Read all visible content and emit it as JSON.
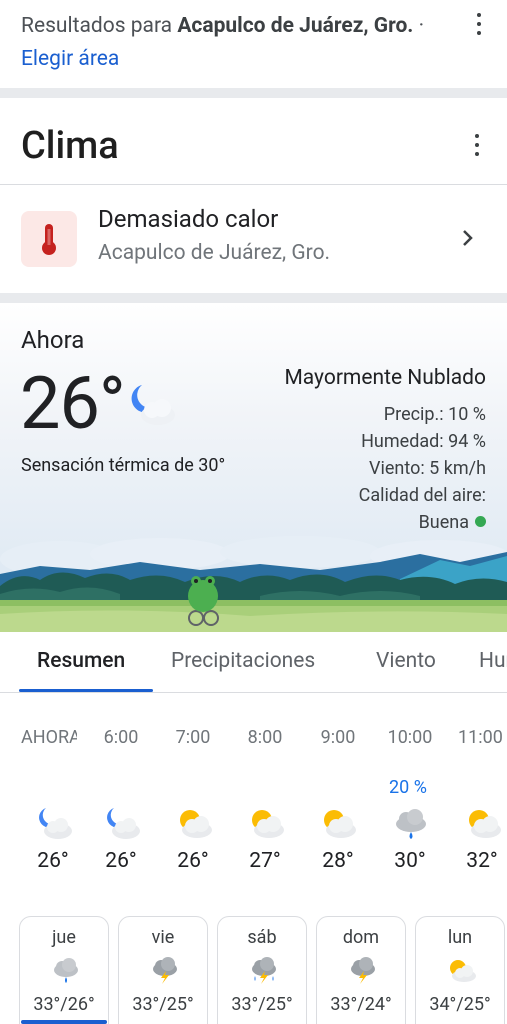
{
  "results": {
    "prefix": "Resultados para ",
    "location": "Acapulco de Juárez, Gro.",
    "separator": " · ",
    "link": "Elegir área"
  },
  "card": {
    "title": "Clima"
  },
  "alert": {
    "title": "Demasiado calor",
    "subtitle": "Acapulco de Juárez, Gro."
  },
  "current": {
    "label": "Ahora",
    "temp": "26°",
    "feels_like": "Sensación térmica de 30°",
    "condition": "Mayormente Nublado",
    "precip": "Precip.: 10 %",
    "humidity": "Humedad: 94 %",
    "wind": "Viento: 5 km/h",
    "air_quality_label": "Calidad del aire:",
    "air_quality_value": "Buena",
    "air_quality_color": "#34a853"
  },
  "tabs": [
    {
      "label": "Resumen"
    },
    {
      "label": "Precipitaciones"
    },
    {
      "label": "Viento"
    },
    {
      "label": "Humedad"
    }
  ],
  "hourly": [
    {
      "time": "AHORA",
      "temp": "26°",
      "precip": "",
      "icon": "night-partly-cloudy-icon"
    },
    {
      "time": "6:00",
      "temp": "26°",
      "precip": "",
      "icon": "night-partly-cloudy-icon"
    },
    {
      "time": "7:00",
      "temp": "26°",
      "precip": "",
      "icon": "partly-cloudy-icon"
    },
    {
      "time": "8:00",
      "temp": "27°",
      "precip": "",
      "icon": "partly-cloudy-icon"
    },
    {
      "time": "9:00",
      "temp": "28°",
      "precip": "",
      "icon": "partly-cloudy-icon"
    },
    {
      "time": "10:00",
      "temp": "30°",
      "precip": "20 %",
      "icon": "rain-cloud-icon"
    },
    {
      "time": "11:00",
      "temp": "32°",
      "precip": "",
      "icon": "partly-cloudy-icon"
    }
  ],
  "daily": [
    {
      "day": "jue",
      "temps": "33°/26°",
      "icon": "rain-cloud-icon"
    },
    {
      "day": "vie",
      "temps": "33°/25°",
      "icon": "thunderstorm-icon"
    },
    {
      "day": "sáb",
      "temps": "33°/25°",
      "icon": "thunderstorm-rain-icon"
    },
    {
      "day": "dom",
      "temps": "33°/24°",
      "icon": "thunderstorm-icon"
    },
    {
      "day": "lun",
      "temps": "34°/25°",
      "icon": "partly-cloudy-icon"
    }
  ]
}
